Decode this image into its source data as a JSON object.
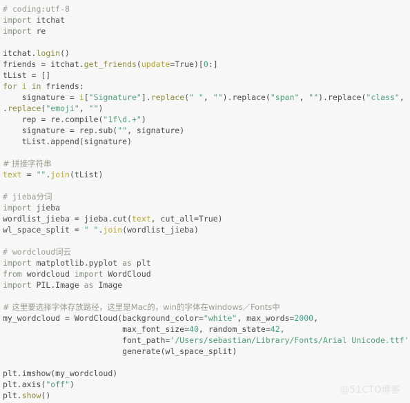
{
  "editor": {
    "language": "python",
    "background_color": "#f7f7f7",
    "default_text_color": "#4c4c4c",
    "lines": [
      "# coding:utf-8",
      "import itchat",
      "import re",
      "",
      "itchat.login()",
      "friends = itchat.get_friends(update=True)[0:]",
      "tList = []",
      "for i in friends:",
      "    signature = i[\"Signature\"].replace(\" \", \"\").replace(\"span\", \"\").replace(\"class\", \"\")",
      ".replace(\"emoji\", \"\")",
      "    rep = re.compile(\"1f\\d.+\")",
      "    signature = rep.sub(\"\", signature)",
      "    tList.append(signature)",
      "",
      "# 拼接字符串",
      "text = \"\".join(tList)",
      "",
      "# jieba分词",
      "import jieba",
      "wordlist_jieba = jieba.cut(text, cut_all=True)",
      "wl_space_split = \" \".join(wordlist_jieba)",
      "",
      "# wordcloud词云",
      "import matplotlib.pyplot as plt",
      "from wordcloud import WordCloud",
      "import PIL.Image as Image",
      "",
      "# 这里要选择字体存放路径，这里是Mac的，win的字体在windows／Fonts中",
      "my_wordcloud = WordCloud(background_color=\"white\", max_words=2000,",
      "                         max_font_size=40, random_state=42,",
      "                         font_path='/Users/sebastian/Library/Fonts/Arial Unicode.ttf').",
      "                         generate(wl_space_split)",
      "",
      "plt.imshow(my_wordcloud)",
      "plt.axis(\"off\")",
      "plt.show()"
    ],
    "tokens": [
      [
        [
          "# coding:utf-8",
          "t-comment"
        ]
      ],
      [
        [
          "import",
          "t-kw2"
        ],
        [
          " itchat",
          "t-plain"
        ]
      ],
      [
        [
          "import",
          "t-kw2"
        ],
        [
          " re",
          "t-plain"
        ]
      ],
      [],
      [
        [
          "itchat.",
          "t-plain"
        ],
        [
          "login",
          "t-method"
        ],
        [
          "()",
          "t-plain"
        ]
      ],
      [
        [
          "friends = itchat.",
          "t-plain"
        ],
        [
          "get_friends",
          "t-method"
        ],
        [
          "(",
          "t-plain"
        ],
        [
          "update",
          "t-ident"
        ],
        [
          "=True)[",
          "t-plain"
        ],
        [
          "0",
          "t-number"
        ],
        [
          ":]",
          "t-plain"
        ]
      ],
      [
        [
          "tList = []",
          "t-plain"
        ]
      ],
      [
        [
          "for",
          "t-keyword"
        ],
        [
          " ",
          "t-plain"
        ],
        [
          "i",
          "t-ident"
        ],
        [
          " ",
          "t-plain"
        ],
        [
          "in",
          "t-keyword"
        ],
        [
          " friends:",
          "t-plain"
        ]
      ],
      [
        [
          "    signature = ",
          "t-plain"
        ],
        [
          "i",
          "t-ident"
        ],
        [
          "[",
          "t-plain"
        ],
        [
          "\"Signature\"",
          "t-string"
        ],
        [
          "].",
          "t-plain"
        ],
        [
          "replace",
          "t-method"
        ],
        [
          "(",
          "t-plain"
        ],
        [
          "\" \"",
          "t-string"
        ],
        [
          ", ",
          "t-plain"
        ],
        [
          "\"\"",
          "t-string"
        ],
        [
          ").",
          "t-plain"
        ],
        [
          "replace",
          "t-plain"
        ],
        [
          "(",
          "t-plain"
        ],
        [
          "\"span\"",
          "t-string"
        ],
        [
          ", ",
          "t-plain"
        ],
        [
          "\"\"",
          "t-string"
        ],
        [
          ").",
          "t-plain"
        ],
        [
          "replace",
          "t-plain"
        ],
        [
          "(",
          "t-plain"
        ],
        [
          "\"class\"",
          "t-string"
        ],
        [
          ", ",
          "t-plain"
        ],
        [
          "\"\"",
          "t-string"
        ],
        [
          ")",
          "t-plain"
        ]
      ],
      [
        [
          ".",
          "t-plain"
        ],
        [
          "replace",
          "t-method"
        ],
        [
          "(",
          "t-plain"
        ],
        [
          "\"emoji\"",
          "t-string"
        ],
        [
          ", ",
          "t-plain"
        ],
        [
          "\"\"",
          "t-string"
        ],
        [
          ")",
          "t-plain"
        ]
      ],
      [
        [
          "    rep = re.",
          "t-plain"
        ],
        [
          "compile",
          "t-plain"
        ],
        [
          "(",
          "t-plain"
        ],
        [
          "\"1f\\d.+\"",
          "t-string"
        ],
        [
          ")",
          "t-plain"
        ]
      ],
      [
        [
          "    signature = rep.",
          "t-plain"
        ],
        [
          "sub",
          "t-plain"
        ],
        [
          "(",
          "t-plain"
        ],
        [
          "\"\"",
          "t-string"
        ],
        [
          ", signature)",
          "t-plain"
        ]
      ],
      [
        [
          "    tList.",
          "t-plain"
        ],
        [
          "append",
          "t-plain"
        ],
        [
          "(signature)",
          "t-plain"
        ]
      ],
      [],
      [
        [
          "# 拼接字符串",
          "t-cjk"
        ]
      ],
      [
        [
          "text",
          "t-ident"
        ],
        [
          " = ",
          "t-plain"
        ],
        [
          "\"\"",
          "t-string"
        ],
        [
          ".",
          "t-plain"
        ],
        [
          "join",
          "t-func"
        ],
        [
          "(tList)",
          "t-plain"
        ]
      ],
      [],
      [
        [
          "# jieba",
          "t-comment"
        ],
        [
          "分词",
          "t-cjk"
        ]
      ],
      [
        [
          "import",
          "t-kw2"
        ],
        [
          " jieba",
          "t-plain"
        ]
      ],
      [
        [
          "wordlist_jieba = jieba.",
          "t-plain"
        ],
        [
          "cut",
          "t-plain"
        ],
        [
          "(",
          "t-plain"
        ],
        [
          "text",
          "t-ident"
        ],
        [
          ", cut_all=True)",
          "t-plain"
        ]
      ],
      [
        [
          "wl_space_split = ",
          "t-plain"
        ],
        [
          "\" \"",
          "t-string"
        ],
        [
          ".",
          "t-plain"
        ],
        [
          "join",
          "t-func"
        ],
        [
          "(wordlist_jieba)",
          "t-plain"
        ]
      ],
      [],
      [
        [
          "# wordcloud",
          "t-comment"
        ],
        [
          "词云",
          "t-cjk"
        ]
      ],
      [
        [
          "import",
          "t-kw2"
        ],
        [
          " matplotlib.pyplot ",
          "t-plain"
        ],
        [
          "as",
          "t-kw2"
        ],
        [
          " plt",
          "t-plain"
        ]
      ],
      [
        [
          "from",
          "t-kw2"
        ],
        [
          " wordcloud ",
          "t-plain"
        ],
        [
          "import",
          "t-kw2"
        ],
        [
          " WordCloud",
          "t-plain"
        ]
      ],
      [
        [
          "import",
          "t-kw2"
        ],
        [
          " PIL.Image ",
          "t-plain"
        ],
        [
          "as",
          "t-kw2"
        ],
        [
          " Image",
          "t-plain"
        ]
      ],
      [],
      [
        [
          "# 这里要选择字体存放路径，这里是Mac的，win的字体在windows／Fonts中",
          "t-cjk"
        ]
      ],
      [
        [
          "my_wordcloud = WordCloud(background_color=",
          "t-plain"
        ],
        [
          "\"white\"",
          "t-string"
        ],
        [
          ", max_words=",
          "t-plain"
        ],
        [
          "2000",
          "t-number"
        ],
        [
          ",",
          "t-plain"
        ]
      ],
      [
        [
          "                         max_font_size=",
          "t-plain"
        ],
        [
          "40",
          "t-number"
        ],
        [
          ", random_state=",
          "t-plain"
        ],
        [
          "42",
          "t-number"
        ],
        [
          ",",
          "t-plain"
        ]
      ],
      [
        [
          "                         font_path=",
          "t-plain"
        ],
        [
          "'/Users/sebastian/Library/Fonts/Arial Unicode.ttf'",
          "t-string"
        ],
        [
          ").",
          "t-plain"
        ]
      ],
      [
        [
          "                         generate(wl_space_split)",
          "t-plain"
        ]
      ],
      [],
      [
        [
          "plt.",
          "t-plain"
        ],
        [
          "imshow",
          "t-plain"
        ],
        [
          "(my_wordcloud)",
          "t-plain"
        ]
      ],
      [
        [
          "plt.",
          "t-plain"
        ],
        [
          "axis",
          "t-plain"
        ],
        [
          "(",
          "t-plain"
        ],
        [
          "\"off\"",
          "t-string"
        ],
        [
          ")",
          "t-plain"
        ]
      ],
      [
        [
          "plt.",
          "t-plain"
        ],
        [
          "show",
          "t-method"
        ],
        [
          "()",
          "t-plain"
        ]
      ]
    ]
  },
  "watermark": {
    "text": "@51CTO博客",
    "color": "#e2e2e2"
  }
}
